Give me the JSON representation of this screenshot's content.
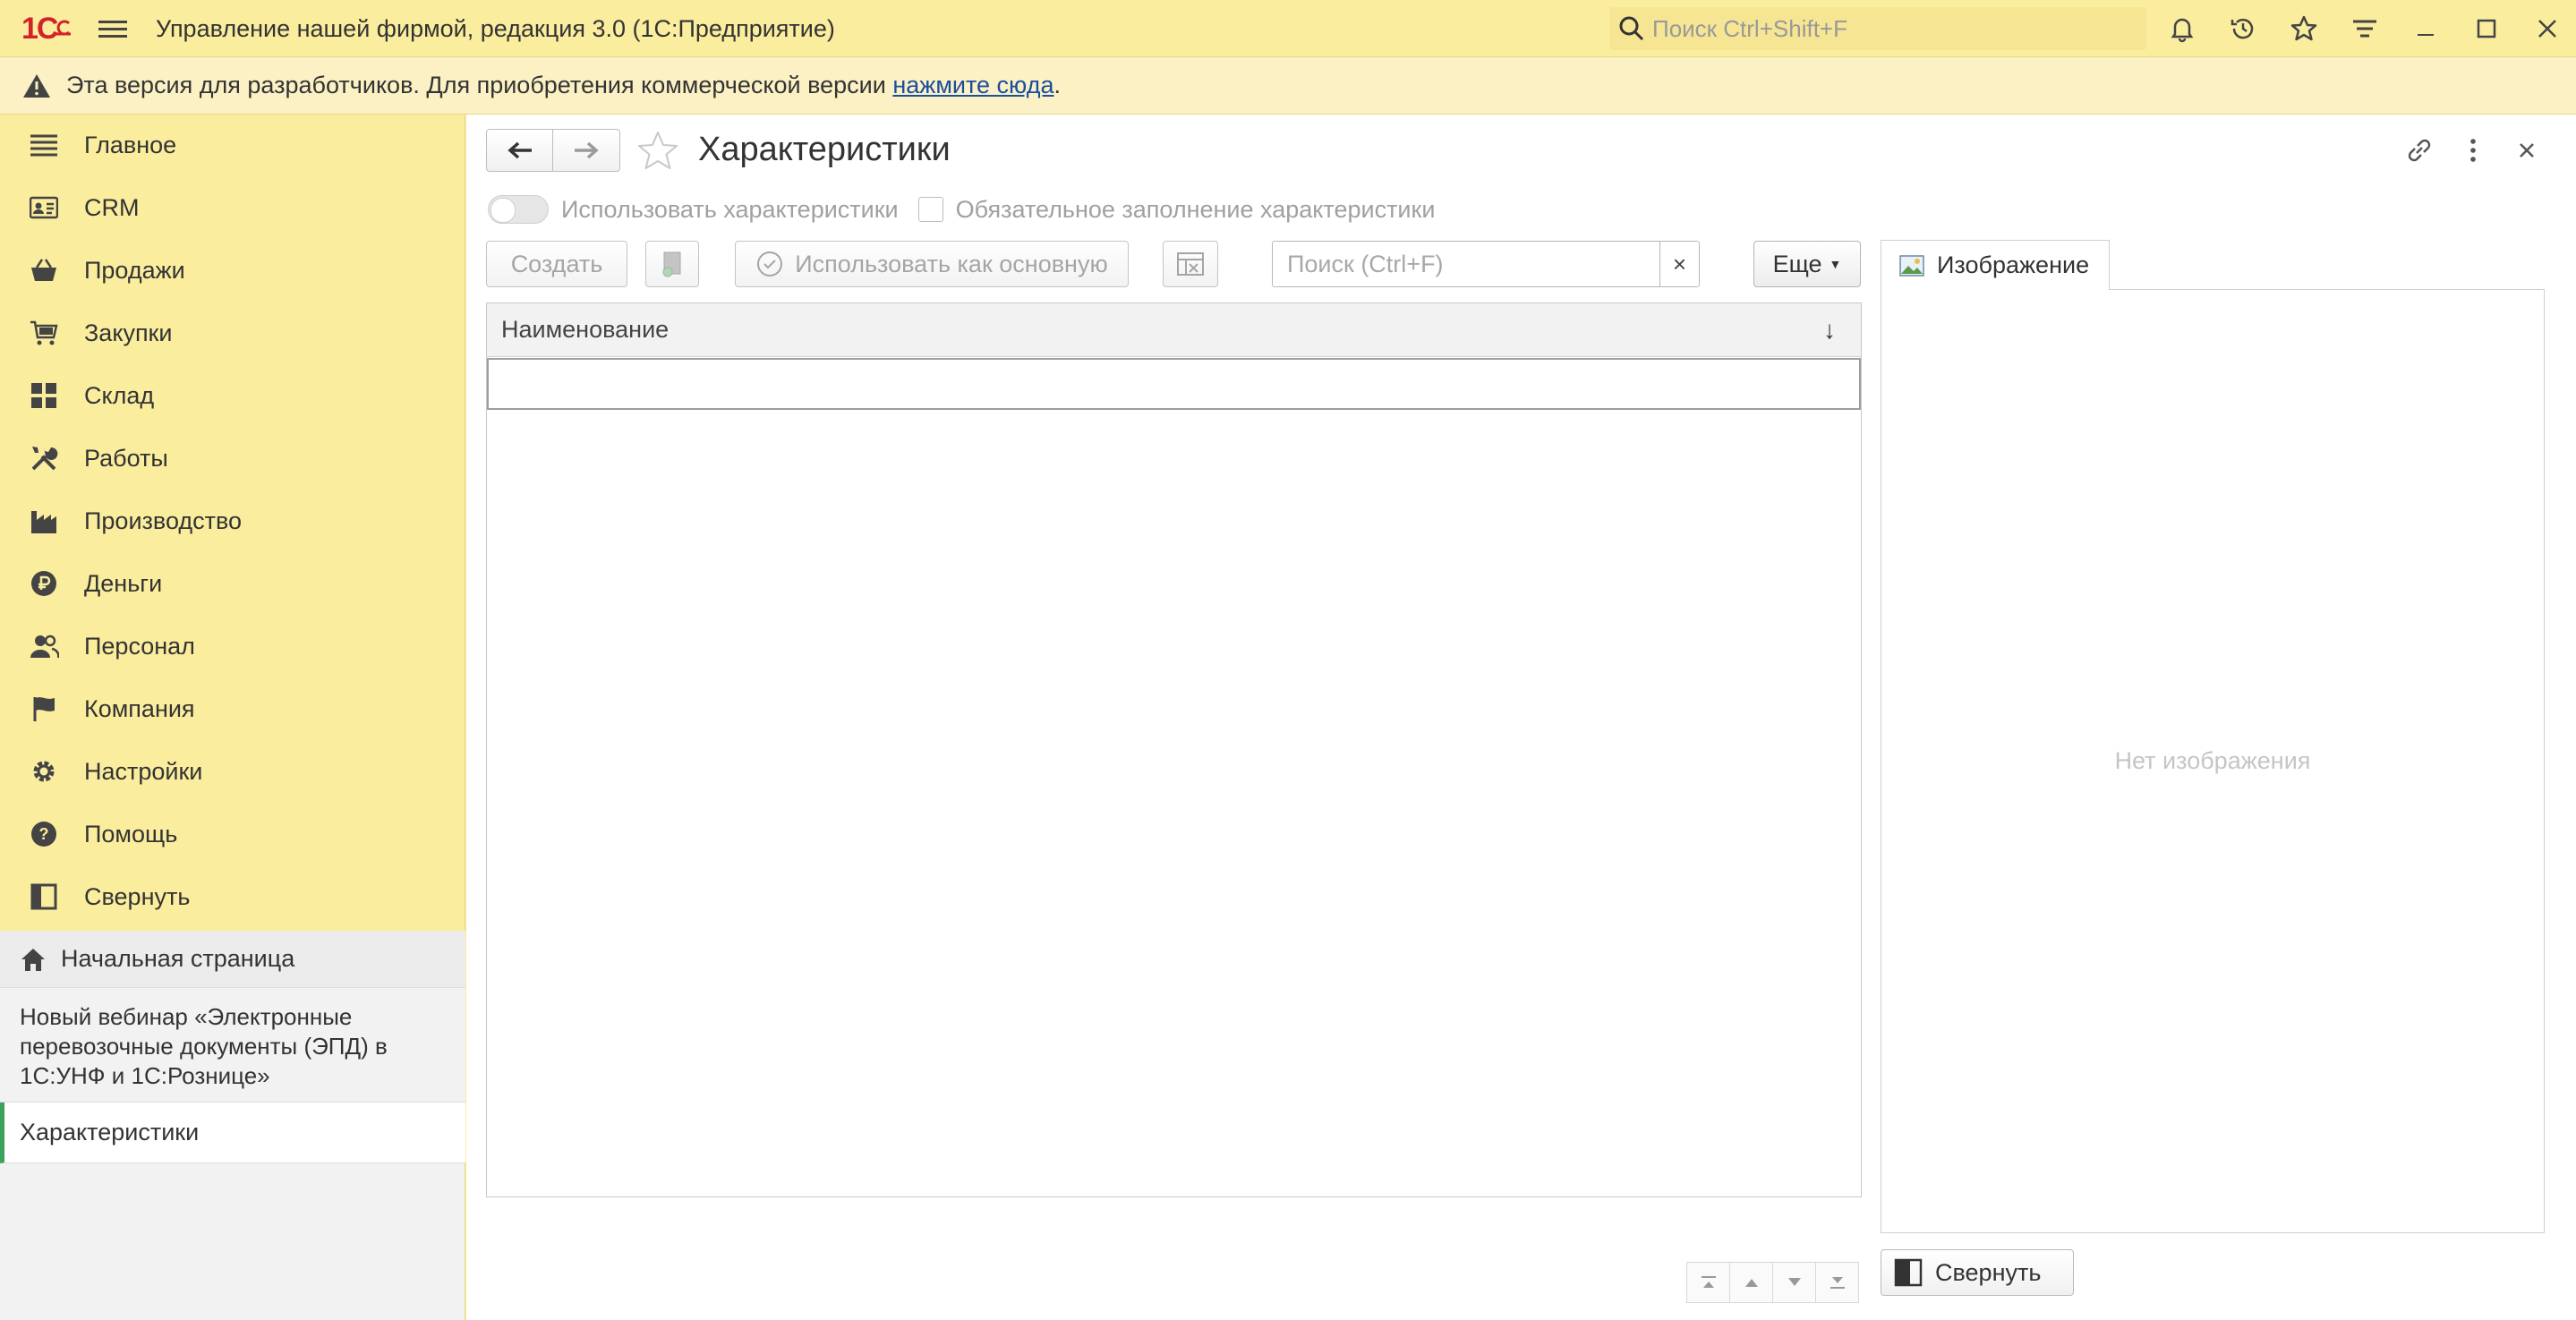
{
  "app": {
    "logo_text": "1С",
    "title": "Управление нашей фирмой, редакция 3.0  (1С:Предприятие)",
    "search_placeholder": "Поиск Ctrl+Shift+F"
  },
  "banner": {
    "text": "Эта версия для разработчиков. Для приобретения коммерческой версии ",
    "link": "нажмите сюда",
    "suffix": "."
  },
  "sidebar": {
    "items": [
      {
        "label": "Главное",
        "icon": "menu-lines-icon"
      },
      {
        "label": "CRM",
        "icon": "contact-card-icon"
      },
      {
        "label": "Продажи",
        "icon": "basket-icon"
      },
      {
        "label": "Закупки",
        "icon": "cart-icon"
      },
      {
        "label": "Склад",
        "icon": "warehouse-icon"
      },
      {
        "label": "Работы",
        "icon": "tools-icon"
      },
      {
        "label": "Производство",
        "icon": "factory-icon"
      },
      {
        "label": "Деньги",
        "icon": "ruble-icon"
      },
      {
        "label": "Персонал",
        "icon": "people-icon"
      },
      {
        "label": "Компания",
        "icon": "flag-icon"
      },
      {
        "label": "Настройки",
        "icon": "gear-icon"
      },
      {
        "label": "Помощь",
        "icon": "help-icon"
      },
      {
        "label": "Свернуть",
        "icon": "collapse-panel-icon"
      }
    ],
    "open_windows": {
      "home": "Начальная страница",
      "webinar": "Новый вебинар «Электронные перевозочные документы (ЭПД) в 1С:УНФ и 1С:Рознице»",
      "active": "Характеристики"
    }
  },
  "form": {
    "title": "Характеристики",
    "use_characteristics_label": "Использовать характеристики",
    "mandatory_label": "Обязательное заполнение характеристики",
    "buttons": {
      "create": "Создать",
      "use_as_main": "Использовать как основную",
      "more": "Еще"
    },
    "search_placeholder": "Поиск (Ctrl+F)",
    "search_clear": "×",
    "table": {
      "column": "Наименование",
      "sort_indicator": "↓",
      "rows": []
    },
    "image_tab": "Изображение",
    "no_image": "Нет изображения",
    "collapse": "Свернуть"
  },
  "colors": {
    "accent_yellow": "#fbed9e",
    "logo_red": "#d2232a",
    "link_blue": "#1a4ea0",
    "active_marker": "#3aa25a"
  }
}
